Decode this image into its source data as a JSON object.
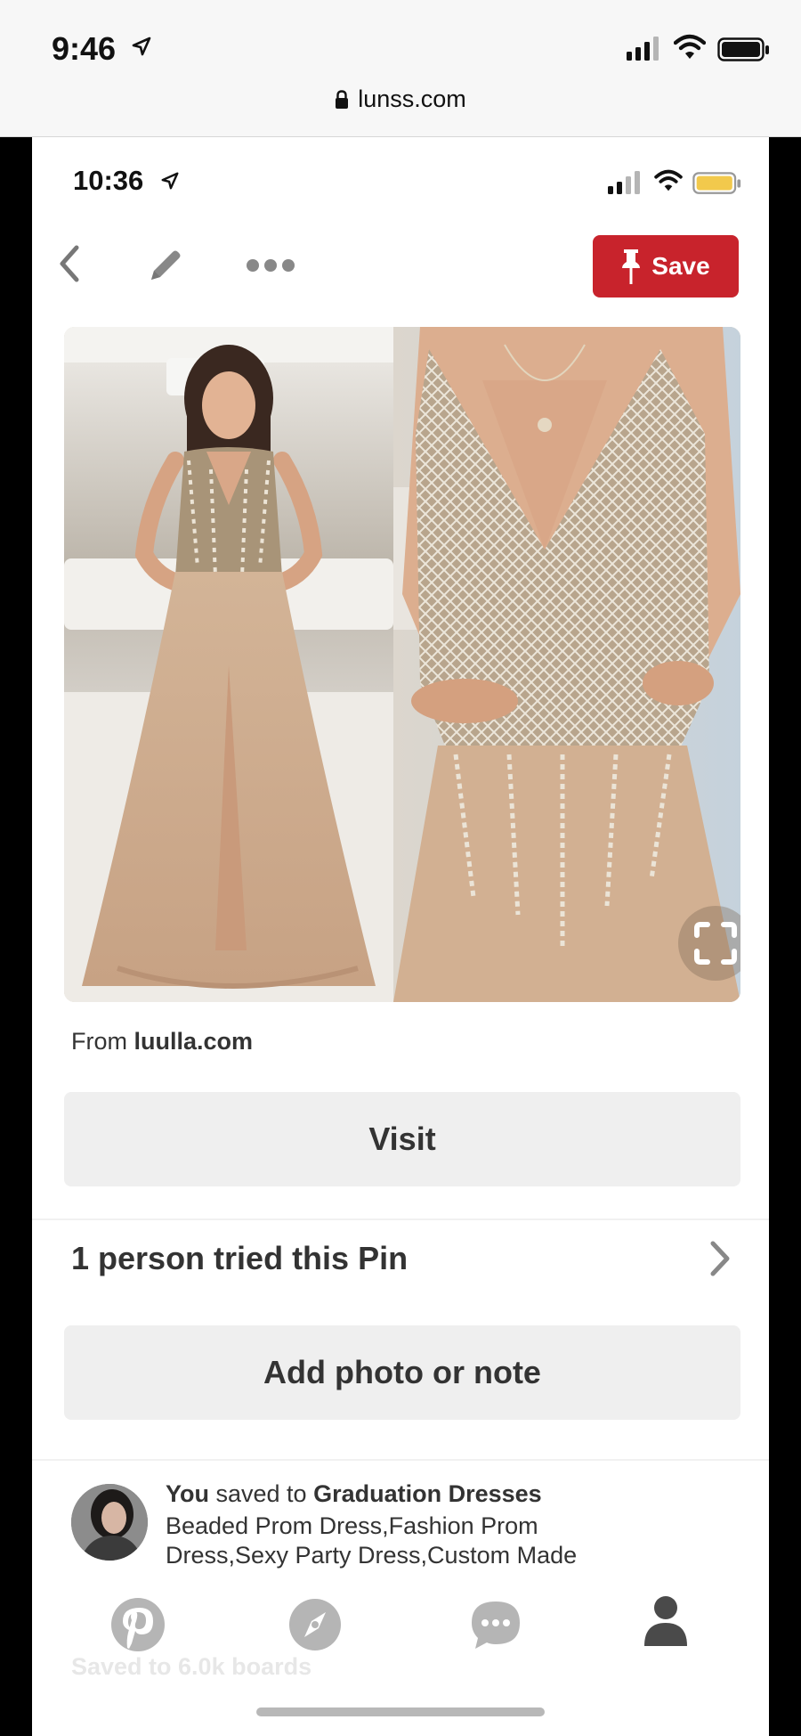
{
  "outer_status": {
    "time": "9:46",
    "url": "lunss.com"
  },
  "inner_status": {
    "time": "10:36"
  },
  "toolbar": {
    "save_label": "Save",
    "accent_color": "#c8232c"
  },
  "pin": {
    "from_prefix": "From ",
    "from_domain": "luulla.com",
    "visit_label": "Visit",
    "tried_text": "1 person tried this Pin",
    "add_note_label": "Add photo or note"
  },
  "activity": {
    "actor": "You",
    "verb": " saved to ",
    "board": "Graduation Dresses",
    "description": "Beaded Prom Dress,Fashion Prom Dress,Sexy Party Dress,Custom Made"
  },
  "faded_text": "Saved to 6.0k boards",
  "nav": {
    "icons": [
      "pinterest-logo-icon",
      "compass-icon",
      "chat-bubble-icon",
      "profile-icon"
    ]
  }
}
